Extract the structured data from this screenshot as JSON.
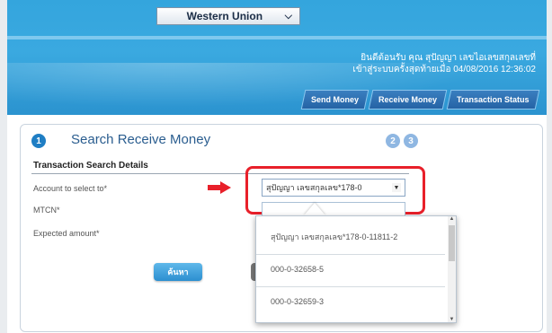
{
  "header": {
    "service_select": "Western Union",
    "welcome_line1": "ยินดีต้อนรับ คุณ สุปัญญา เลขไอเลขสกุลเลขที่",
    "welcome_line2": "เข้าสู่ระบบครั้งสุดท้ายเมื่อ 04/08/2016 12:36:02",
    "tabs": [
      "Send Money",
      "Receive Money",
      "Transaction Status"
    ]
  },
  "panel": {
    "steps": [
      "1",
      "2",
      "3"
    ],
    "title": "Search Receive Money",
    "section_title": "Transaction Search Details",
    "labels": {
      "account": "Account to select to*",
      "mtcn": "MTCN*",
      "expected_amount": "Expected amount*"
    },
    "account_value": "สุปัญญา เลขสกุลเลข*178-0",
    "search_button": "ค้นหา"
  },
  "dropdown": {
    "options": [
      "สุปัญญา เลขสกุลเลข*178-0-11811-2",
      "000-0-32658-5",
      "000-0-32659-3"
    ]
  },
  "colors": {
    "header_blue": "#34a5dd",
    "highlight_red": "#e8202a",
    "title_blue": "#2a5d8f"
  }
}
